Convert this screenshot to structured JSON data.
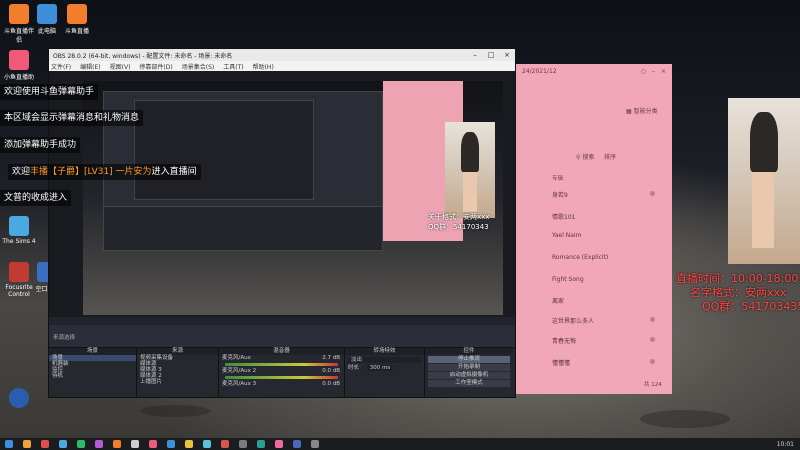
{
  "desktop": {
    "icons": [
      {
        "label": "斗鱼直播伴侣",
        "color": "#f27d2a"
      },
      {
        "label": "此电脑",
        "color": "#3d8fd9"
      },
      {
        "label": "斗鱼直播",
        "color": "#f27d2a"
      },
      {
        "label": "小鱼直播助",
        "color": "#ef5a79"
      },
      {
        "label": "The Sims 4",
        "color": "#4aa9e0"
      },
      {
        "label": "Focusrite Control",
        "color": "#c23b33"
      },
      {
        "label": "空口 Plo",
        "color": "#3a6fbf"
      }
    ]
  },
  "chat_overlay": {
    "line1": "欢迎使用斗鱼弹幕助手",
    "line2": "本区域会显示弹幕消息和礼物消息",
    "line3": "添加弹幕助手成功",
    "line4_prefix": "欢迎",
    "line4_user": "丰播",
    "line4_badge": "【子爵】[LV31] 一片安为",
    "line4_suffix": "进入直播间",
    "line5": "文普的收成进入"
  },
  "obs": {
    "title": "OBS 28.0.2 (64-bit, windows) - 配置文件: 未命名 - 场景: 未命名",
    "menu": [
      "文件(F)",
      "编辑(E)",
      "视图(V)",
      "停靠部件(D)",
      "场景集合(S)",
      "工具(T)",
      "帮助(H)"
    ],
    "status": "来源选择",
    "docks": {
      "scenes": {
        "title": "场景",
        "items": [
          "场景",
          "机器装",
          "监控",
          "待机"
        ]
      },
      "sources": {
        "title": "来源",
        "items": [
          "视频采集设备",
          "媒体源",
          "媒体源 3",
          "媒体源 2",
          "上播图片",
          "图像"
        ]
      },
      "mixer": {
        "title": "混音器",
        "channels": [
          "麦克风/Aux",
          "麦克风/Aux 2",
          "麦克风/Aux 3"
        ],
        "levels": [
          "2.7 dB",
          "0.0 dB",
          "0.0 dB"
        ]
      },
      "transitions": {
        "title": "转场特效",
        "fade": "淡出",
        "duration_label": "时长",
        "duration": "300 ms"
      },
      "controls": {
        "title": "控件",
        "buttons": [
          "停止推流",
          "开始录制",
          "启动虚拟摄像机",
          "工作室模式",
          "设置",
          "退出"
        ]
      }
    },
    "footer": "LIVE: 00:00:00   REC: 00:00:00   CPU: 1.4%, 60.00 fps"
  },
  "pink_panel": {
    "title": "24/2021/12",
    "tabs": [
      "搜索",
      "排序"
    ],
    "settings_label": "智能分类",
    "section": "专辑",
    "songs": [
      "身若9",
      "情歌101",
      "Yael Naim",
      "Romance (Explicit)",
      "Fight Song",
      "离家",
      "这世界那么多人",
      "青春无悔",
      "懂懂懂"
    ],
    "footer": "共 124"
  },
  "stream_info": {
    "time_label": "直播时间：",
    "time_value": "10:00-18:00",
    "name_label": "名字格式：",
    "name_value": "安两xxx",
    "qq_label": "QQ群：",
    "qq_value": "541703435",
    "small_label": "关于格式：安两xxx",
    "small_qq": "QQ群：54170343"
  },
  "taskbar": {
    "clock": "10:01",
    "icon_colors": [
      "#3a8ee6",
      "#f0a23c",
      "#e34d4d",
      "#4aa9e0",
      "#2dbb6b",
      "#b45cd6",
      "#f27d2a",
      "#cfcfcf",
      "#ef5a79",
      "#3d8fd9",
      "#e6c33a",
      "#5bc0de",
      "#d9534f",
      "#7c7c7c",
      "#2c9e8f",
      "#f06aa0",
      "#4a69bd",
      "#888"
    ]
  },
  "colors": {
    "pink_panel": "#f1a7b8",
    "red_info": "#ff4444",
    "gift_orange": "#ff9a2a"
  }
}
